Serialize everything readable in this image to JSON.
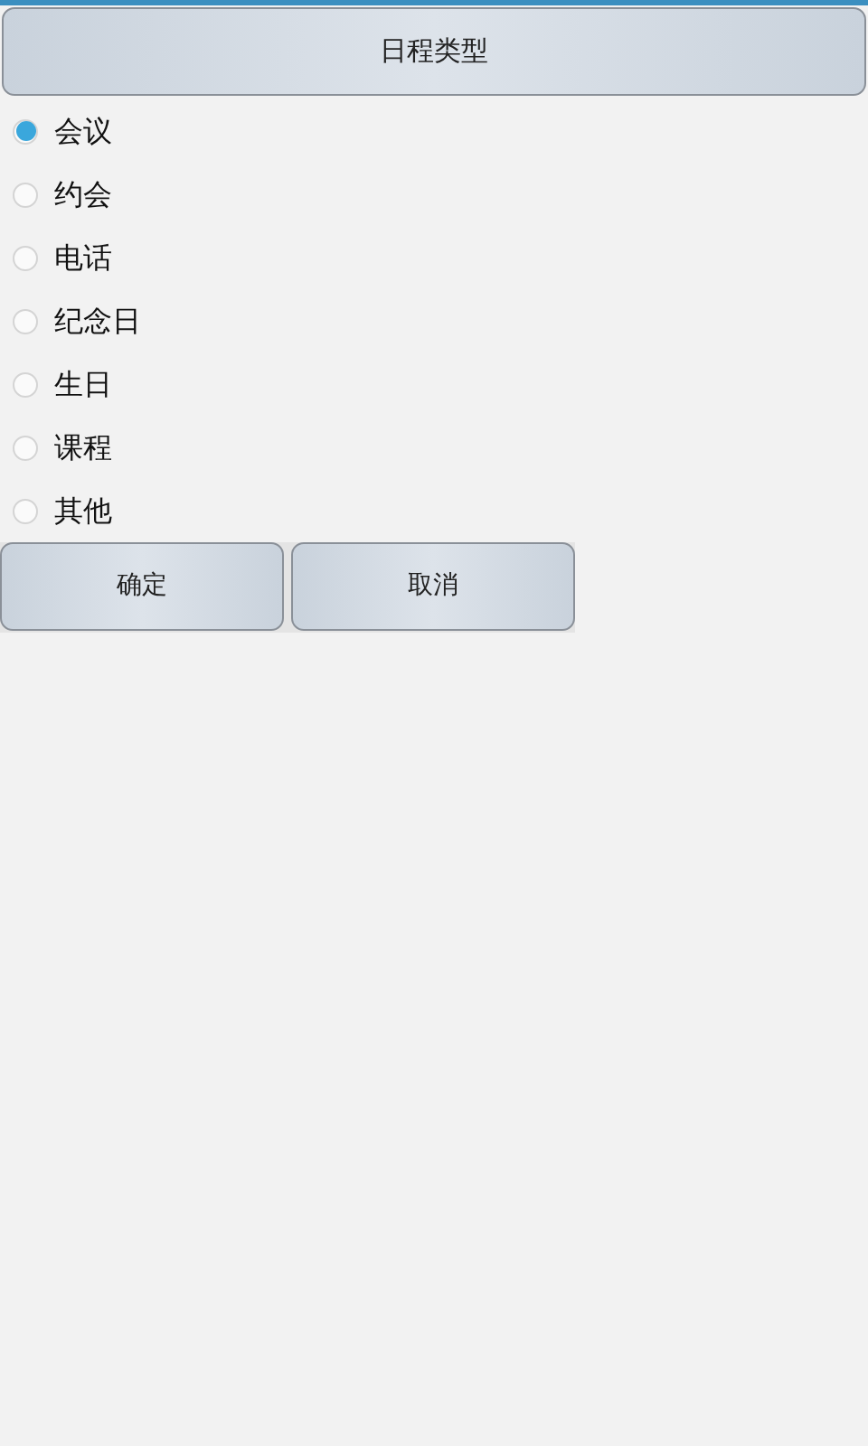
{
  "title": "日程类型",
  "options": [
    {
      "label": "会议",
      "selected": true
    },
    {
      "label": "约会",
      "selected": false
    },
    {
      "label": "电话",
      "selected": false
    },
    {
      "label": "纪念日",
      "selected": false
    },
    {
      "label": "生日",
      "selected": false
    },
    {
      "label": "课程",
      "selected": false
    },
    {
      "label": "其他",
      "selected": false
    }
  ],
  "buttons": [
    "确定",
    "取消"
  ]
}
